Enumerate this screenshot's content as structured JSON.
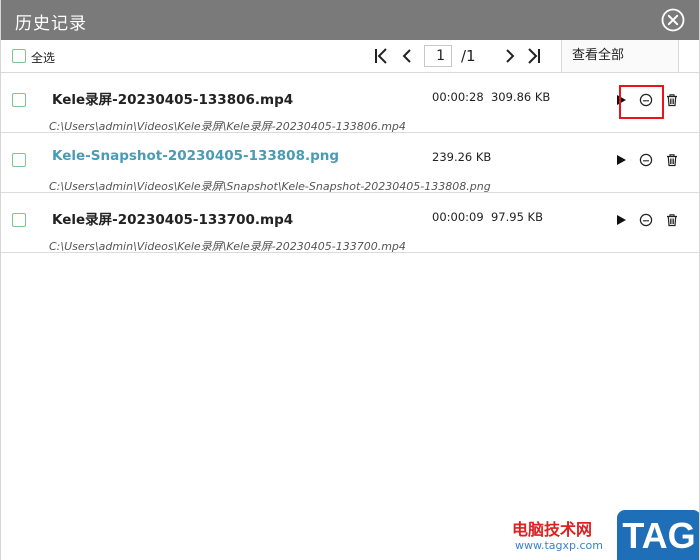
{
  "window": {
    "title": "历史记录"
  },
  "toolbar": {
    "select_all_label": "全选",
    "current_page": "1",
    "total_pages": "/1",
    "view_all_label": "查看全部"
  },
  "files": [
    {
      "name": "Kele录屏-20230405-133806.mp4",
      "duration": "00:00:28",
      "size": "309.86 KB",
      "path": "C:\\Users\\admin\\Videos\\Kele录屏\\Kele录屏-20230405-133806.mp4"
    },
    {
      "name": "Kele-Snapshot-20230405-133808.png",
      "duration": "",
      "size": "239.26 KB",
      "path": "C:\\Users\\admin\\Videos\\Kele录屏\\Snapshot\\Kele-Snapshot-20230405-133808.png"
    },
    {
      "name": "Kele录屏-20230405-133700.mp4",
      "duration": "00:00:09",
      "size": "97.95 KB",
      "path": "C:\\Users\\admin\\Videos\\Kele录屏\\Kele录屏-20230405-133700.mp4"
    }
  ],
  "icons": {
    "close": "close-circle-icon",
    "first_page": "first-page-icon",
    "prev_page": "chevron-left-icon",
    "next_page": "chevron-right-icon",
    "last_page": "last-page-icon",
    "play": "play-icon",
    "folder": "open-folder-icon",
    "delete": "trash-icon"
  },
  "colors": {
    "titlebar": "#7a7a7a",
    "checkbox_border": "#7fc48c",
    "link_text": "#4a9bb5",
    "highlight": "#e8141b"
  },
  "watermark": {
    "text": "电脑技术网",
    "url": "www.tagxp.com",
    "logo": "TAG"
  }
}
